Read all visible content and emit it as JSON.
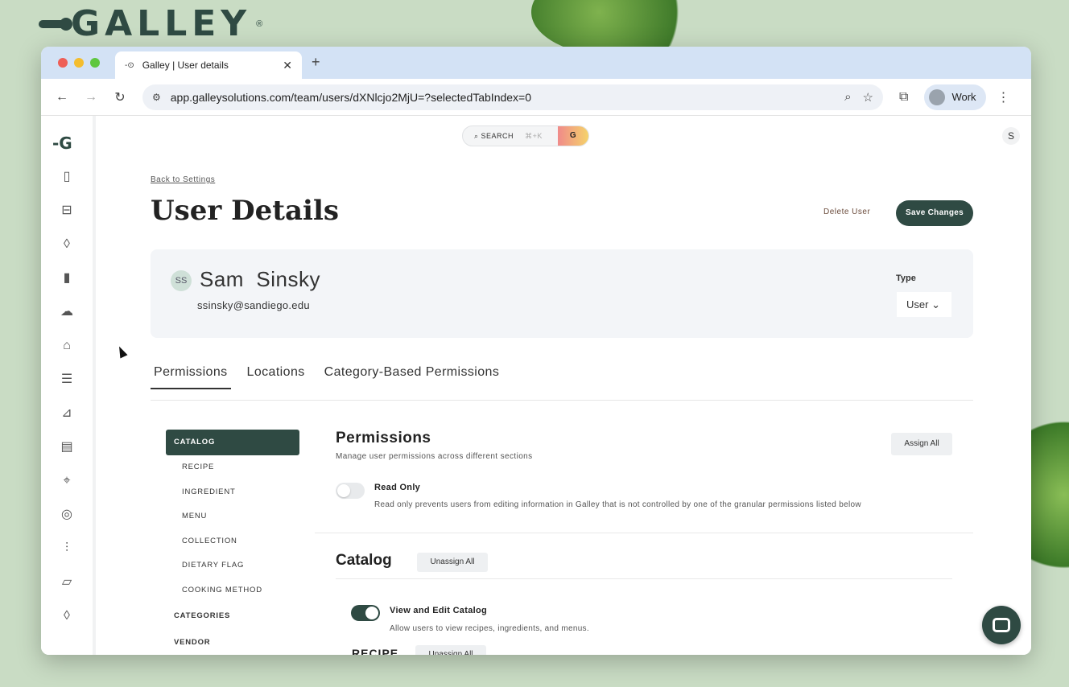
{
  "brand": {
    "name": "GALLEY",
    "reg": "®"
  },
  "browser": {
    "tab_title": "Galley | User details",
    "tab_favicon": "-⊙",
    "new_tab": "+",
    "url": "app.galleysolutions.com/team/users/dXNlcjo2MjU=?selectedTabIndex=0",
    "profile_label": "Work"
  },
  "app": {
    "search_label": "SEARCH",
    "search_shortcut": "⌘+K",
    "search_badge": "G",
    "user_initial": "S",
    "sidebar_logo": "-G",
    "sidebar_icons": [
      "clipboard-icon",
      "book-icon",
      "onion-icon",
      "bottles-icon",
      "chef-hat-icon",
      "tag-icon",
      "checklist-icon",
      "cart-icon",
      "document-icon",
      "location-pin-icon",
      "plate-icon",
      "sliders-icon",
      "menu-board-icon",
      "onion-alt-icon"
    ]
  },
  "page": {
    "back_link": "Back to Settings",
    "title": "User Details",
    "delete_label": "Delete User",
    "save_label": "Save Changes"
  },
  "user": {
    "initials": "SS",
    "name": "Sam  Sinsky",
    "email": "ssinsky@sandiego.edu",
    "type_label": "Type",
    "type_value": "User"
  },
  "tabs": [
    {
      "label": "Permissions",
      "active": true
    },
    {
      "label": "Locations",
      "active": false
    },
    {
      "label": "Category-Based Permissions",
      "active": false
    }
  ],
  "perm_nav": {
    "catalog": "CATALOG",
    "sub": [
      "RECIPE",
      "INGREDIENT",
      "MENU",
      "COLLECTION",
      "DIETARY FLAG",
      "COOKING METHOD"
    ],
    "categories": "CATEGORIES",
    "vendor": "VENDOR"
  },
  "permissions": {
    "heading": "Permissions",
    "subtitle": "Manage user permissions across different sections",
    "assign_all": "Assign All",
    "read_only_label": "Read Only",
    "read_only_desc": "Read only prevents users from editing information in Galley that is not controlled by one of the granular permissions listed below",
    "read_only_on": false,
    "catalog_heading": "Catalog",
    "unassign_all": "Unassign All",
    "view_edit_label": "View and Edit Catalog",
    "view_edit_desc": "Allow users to view recipes, ingredients, and menus.",
    "view_edit_on": true,
    "recipe_heading": "RECIPE"
  }
}
